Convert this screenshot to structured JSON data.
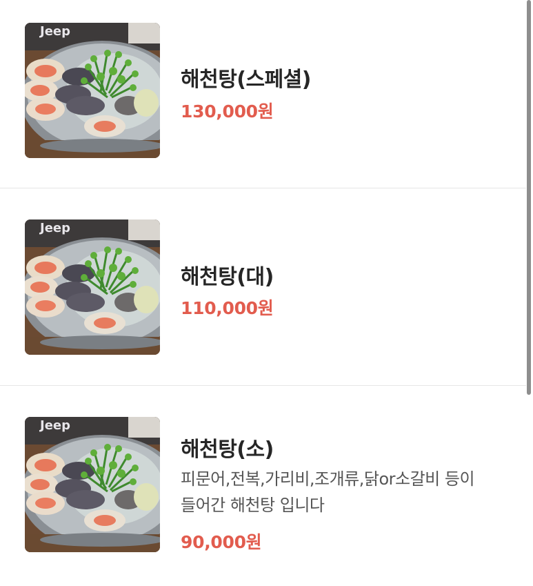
{
  "menu": {
    "items": [
      {
        "name": "해천탕(스페셜)",
        "price": "130,000원",
        "image_icon": "seafood-hot-pot-photo"
      },
      {
        "name": "해천탕(대)",
        "price": "110,000원",
        "image_icon": "seafood-hot-pot-photo"
      },
      {
        "name": "해천탕(소)",
        "description_line1": "피문어,전복,가리비,조개류,닭or소갈비 등이",
        "description_line2": "들어간 해천탕 입니다",
        "price": "90,000원",
        "image_icon": "seafood-hot-pot-photo"
      }
    ]
  },
  "colors": {
    "price": "#e25c4e",
    "title": "#262626",
    "divider": "#e6e6e6",
    "description": "#555555"
  }
}
